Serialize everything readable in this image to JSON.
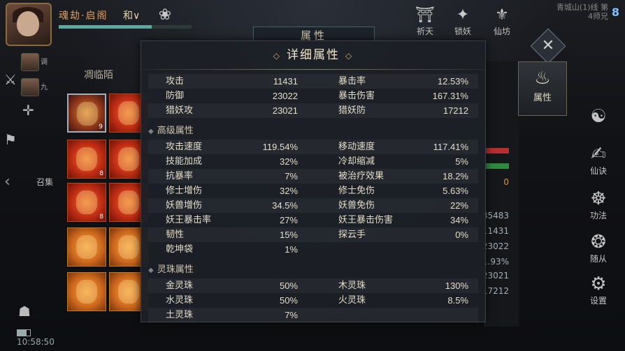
{
  "top": {
    "player_name": "魂劫·启阁",
    "player_sub": "和∨",
    "icons": [
      {
        "label": "",
        "icon": "lotus-icon"
      },
      {
        "label": "祈天",
        "icon": "pagoda-icon"
      },
      {
        "label": "锁妖",
        "icon": "seal-icon"
      },
      {
        "label": "仙坊",
        "icon": "shrine-icon"
      }
    ],
    "counter": "8",
    "corner_text": "青城山(1)线 第4师兄"
  },
  "gate_title": "属性",
  "left": {
    "mini_labels": [
      "调",
      "九"
    ],
    "recruit": "召集",
    "clock": "10:58:50"
  },
  "equip": {
    "header": "凋临陌",
    "slots": [
      {
        "kind": "sel",
        "level": "9"
      },
      {
        "kind": "red",
        "level": ""
      },
      {
        "kind": "red",
        "level": "8"
      },
      {
        "kind": "red",
        "level": ""
      },
      {
        "kind": "red",
        "level": "8"
      },
      {
        "kind": "red",
        "level": ""
      },
      {
        "kind": "orange",
        "level": ""
      },
      {
        "kind": "orange",
        "level": ""
      },
      {
        "kind": "orange",
        "level": ""
      },
      {
        "kind": "orange",
        "level": ""
      }
    ]
  },
  "behind_values": [
    "0",
    "35483",
    "11431",
    "23022",
    "1.93%",
    "23021",
    "17212"
  ],
  "attr_tab": {
    "label": "属性",
    "icon": "flame-mask-icon"
  },
  "right_menu": [
    {
      "label": "",
      "icon": "swirl-icon"
    },
    {
      "label": "仙诀",
      "icon": "scroll-icon"
    },
    {
      "label": "功法",
      "icon": "yin-yang-icon"
    },
    {
      "label": "随从",
      "icon": "beast-icon"
    },
    {
      "label": "设置",
      "icon": "gear-icon"
    }
  ],
  "modal": {
    "title": "详细属性",
    "basic": [
      {
        "l1": "攻击",
        "v1": "11431",
        "l2": "暴击率",
        "v2": "12.53%"
      },
      {
        "l1": "防御",
        "v1": "23022",
        "l2": "暴击伤害",
        "v2": "167.31%"
      },
      {
        "l1": "猎妖攻",
        "v1": "23021",
        "l2": "猎妖防",
        "v2": "17212"
      }
    ],
    "advanced_title": "高级属性",
    "advanced": [
      {
        "l1": "攻击速度",
        "v1": "119.54%",
        "l2": "移动速度",
        "v2": "117.41%"
      },
      {
        "l1": "技能加成",
        "v1": "32%",
        "l2": "冷却缩减",
        "v2": "5%"
      },
      {
        "l1": "抗暴率",
        "v1": "7%",
        "l2": "被治疗效果",
        "v2": "18.2%"
      },
      {
        "l1": "修士增伤",
        "v1": "32%",
        "l2": "修士免伤",
        "v2": "5.63%"
      },
      {
        "l1": "妖兽增伤",
        "v1": "34.5%",
        "l2": "妖兽免伤",
        "v2": "22%"
      },
      {
        "l1": "妖王暴击率",
        "v1": "27%",
        "l2": "妖王暴击伤害",
        "v2": "34%"
      },
      {
        "l1": "韧性",
        "v1": "15%",
        "l2": "探云手",
        "v2": "0%"
      },
      {
        "l1": "乾坤袋",
        "v1": "1%",
        "l2": "",
        "v2": ""
      }
    ],
    "orb_title": "灵珠属性",
    "orbs": [
      {
        "l1": "金灵珠",
        "v1": "50%",
        "l2": "木灵珠",
        "v2": "130%"
      },
      {
        "l1": "水灵珠",
        "v1": "50%",
        "l2": "火灵珠",
        "v2": "8.5%"
      },
      {
        "l1": "土灵珠",
        "v1": "7%",
        "l2": "",
        "v2": ""
      }
    ]
  }
}
